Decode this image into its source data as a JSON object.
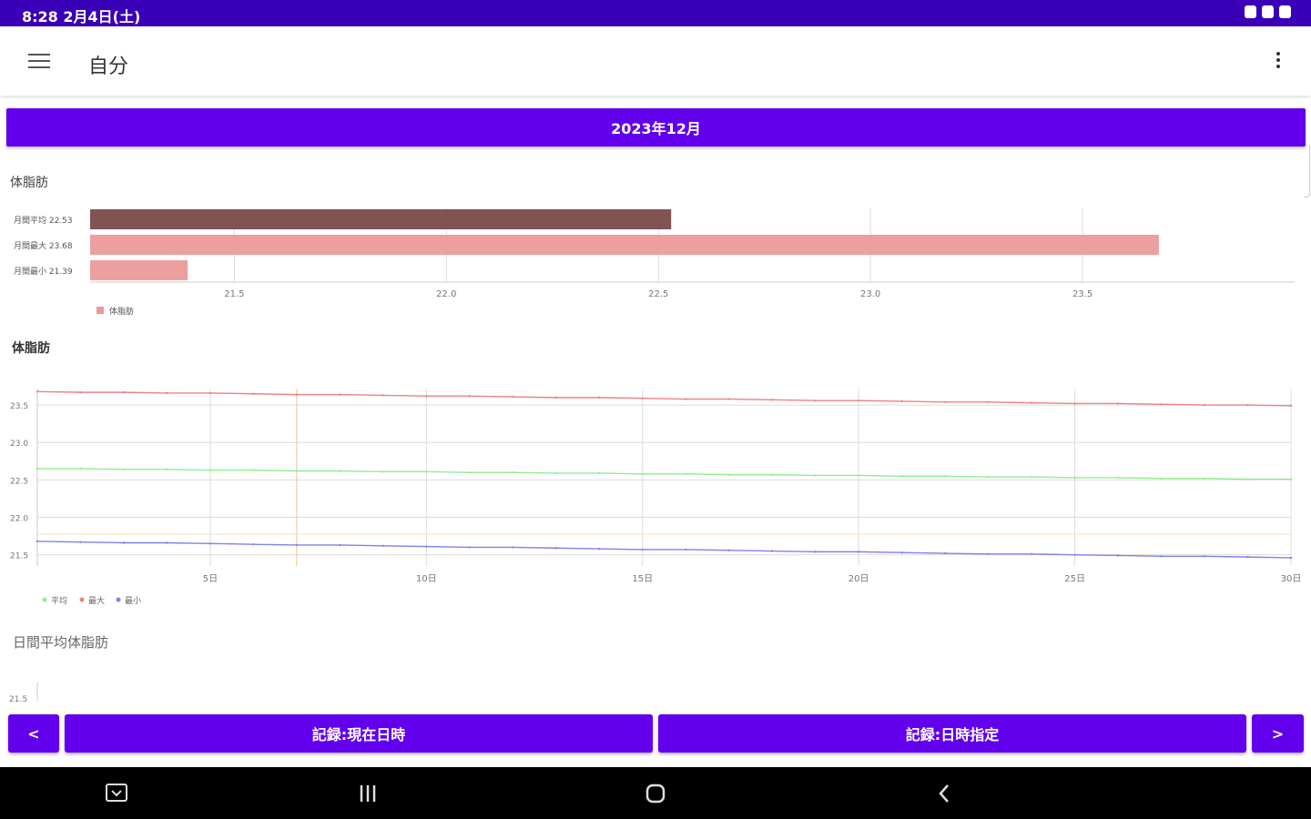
{
  "status": {
    "time": "8:28  2月4日(土)"
  },
  "appbar": {
    "title": "自分",
    "menu_icon": "menu-icon",
    "more_icon": "more-vert-icon"
  },
  "month_button": {
    "label": "2023年12月"
  },
  "bar_chart": {
    "title": "体脂肪",
    "legend": "体脂肪"
  },
  "line_chart": {
    "title": "体脂肪",
    "legend": {
      "avg": "平均",
      "max": "最大",
      "min": "最小"
    }
  },
  "daily_chart": {
    "title": "日間平均体脂肪",
    "first_tick": "21.5"
  },
  "buttons": {
    "prev": "<",
    "record_now": "記録:現在日時",
    "record_specified": "記録:日時指定",
    "next": ">"
  },
  "colors": {
    "accent": "#6200ee",
    "status": "#3a00b8",
    "bar_dark": "#7a4a4a",
    "bar_light": "#eb9a9a",
    "max": "#f08080",
    "avg": "#90ee90",
    "min": "#8080f0"
  },
  "chart_data": [
    {
      "type": "bar",
      "title": "体脂肪",
      "categories": [
        "月間平均 22.53",
        "月間最大 23.68",
        "月間最小 21.39"
      ],
      "values": [
        22.53,
        23.68,
        21.39
      ],
      "xlim": [
        21.16,
        24.0
      ],
      "xticks": [
        "21.5",
        "22.0",
        "22.5",
        "23.0",
        "23.5"
      ],
      "legend": [
        "体脂肪"
      ]
    },
    {
      "type": "line",
      "title": "体脂肪",
      "x": [
        1,
        2,
        3,
        4,
        5,
        6,
        7,
        8,
        9,
        10,
        11,
        12,
        13,
        14,
        15,
        16,
        17,
        18,
        19,
        20,
        21,
        22,
        23,
        24,
        25,
        26,
        27,
        28,
        29,
        30
      ],
      "xticks": [
        "5日",
        "10日",
        "15日",
        "20日",
        "25日",
        "30日"
      ],
      "yticks": [
        "21.5",
        "22.0",
        "22.5",
        "23.0",
        "23.5"
      ],
      "ylim": [
        21.35,
        23.72
      ],
      "series": [
        {
          "name": "最大",
          "values": [
            23.68,
            23.67,
            23.67,
            23.66,
            23.66,
            23.65,
            23.64,
            23.64,
            23.63,
            23.62,
            23.62,
            23.61,
            23.6,
            23.6,
            23.59,
            23.58,
            23.58,
            23.57,
            23.56,
            23.56,
            23.55,
            23.54,
            23.54,
            23.53,
            23.52,
            23.52,
            23.51,
            23.5,
            23.5,
            23.49
          ]
        },
        {
          "name": "平均",
          "values": [
            22.65,
            22.65,
            22.64,
            22.64,
            22.63,
            22.63,
            22.62,
            22.62,
            22.61,
            22.61,
            22.6,
            22.6,
            22.59,
            22.59,
            22.58,
            22.58,
            22.57,
            22.57,
            22.56,
            22.56,
            22.55,
            22.55,
            22.54,
            22.54,
            22.53,
            22.53,
            22.52,
            22.52,
            22.51,
            22.51
          ]
        },
        {
          "name": "最小",
          "values": [
            21.68,
            21.67,
            21.66,
            21.66,
            21.65,
            21.64,
            21.63,
            21.63,
            21.62,
            21.61,
            21.6,
            21.6,
            21.59,
            21.58,
            21.57,
            21.57,
            21.56,
            21.55,
            21.54,
            21.54,
            21.53,
            21.52,
            21.51,
            21.51,
            21.5,
            21.49,
            21.48,
            21.48,
            21.47,
            21.46
          ]
        }
      ],
      "legend": [
        "平均",
        "最大",
        "最小"
      ]
    }
  ]
}
